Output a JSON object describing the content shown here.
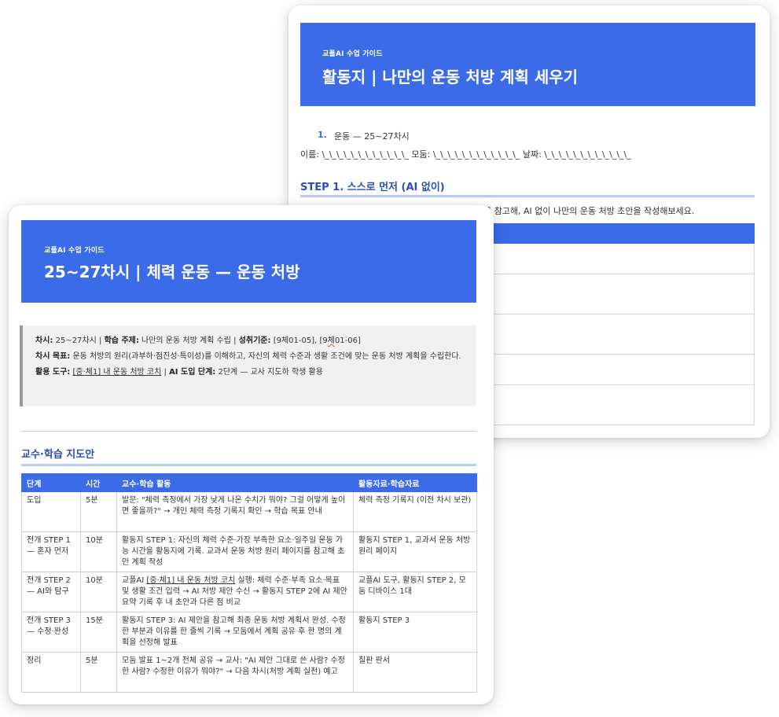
{
  "back": {
    "banner": {
      "sub": "교플AI 수업 가이드",
      "title": "활동지 | 나만의 운동 처방 계획 세우기"
    },
    "list_item": {
      "num": "1.",
      "text": "운동 — 25~27차시"
    },
    "name_line": "이름: \\_\\_\\_\\_\\_\\_\\_\\_\\_\\_\\_\\_ 모둠: \\_\\_\\_\\_\\_\\_\\_\\_\\_\\_\\_\\_ 날짜: \\_\\_\\_\\_\\_\\_\\_\\_\\_\\_\\_\\_",
    "step1": {
      "title": "STEP 1. 스스로 먼저 (AI 없이)",
      "desc_visible": "를 참고해, AI 없이 나만의 운동 처방 초안을 작성해보세요."
    }
  },
  "front": {
    "banner": {
      "sub": "교플AI 수업 가이드",
      "title": "25~27차시 | 체력 운동 — 운동 처방"
    },
    "info": {
      "l1_k1": "차시:",
      "l1_v1": "25~27차시 |",
      "l1_k2": "학습 주제:",
      "l1_v2": "나만의 운동 처방 계획 수립 |",
      "l1_k3": "성취기준:",
      "l1_v3a": "[9체01-05], [9",
      "l1_v3b": "체",
      "l1_v3c": "01-06]",
      "l2_k": "차시 목표:",
      "l2_v": "운동 처방의 원리(과부하·점진성·특이성)를 이해하고, 자신의 체력 수준과 생활 조건에 맞는 운동 처방 계획을 수립한다.",
      "l3_k1": "활용 도구:",
      "l3_v1": "[중·체1] 내 운동 처방 코치",
      "l3_sep": " | ",
      "l3_k2": "AI 도입 단계:",
      "l3_v2": "2단계 — 교사 지도하 학생 활용"
    },
    "section_title": "교수·학습 지도안",
    "table": {
      "headers": [
        "단계",
        "시간",
        "교수·학습 활동",
        "활동자료·학습자료"
      ],
      "rows": [
        {
          "stage": "도입",
          "time": "5분",
          "activity": "발문: \"체력 측정에서 가장 낮게 나온 수치가 뭐야? 그걸 어떻게 높이면 좋을까?\" → 개인 체력 측정 기록지 확인 → 학습 목표 안내",
          "material": "체력 측정 기록지 (이전 차시 보관)"
        },
        {
          "stage": "전개 STEP 1 — 혼자 먼저",
          "time": "10분",
          "activity": "활동지 STEP 1: 자신의 체력 수준·가장 부족한 요소·일주일 운동 가능 시간을 활동지에 기록. 교과서 운동 처방 원리 페이지를 참고해 초안 계획 작성",
          "material": "활동지 STEP 1, 교과서 운동 처방 원리 페이지"
        },
        {
          "stage": "전개 STEP 2 — AI와 탐구",
          "time": "10분",
          "activity_pre": "교플AI ",
          "activity_link": "[중·체1] 내 운동 처방 코치",
          "activity_post": " 실행: 체력 수준·부족 요소·목표 및 생활 조건 입력 → AI 처방 제안 수신 → 활동지 STEP 2에 AI 제안 요약 기록 후 내 초안과 다른 점 비교",
          "material": "교플AI 도구, 활동지 STEP 2, 모둠 디바이스 1대"
        },
        {
          "stage": "전개 STEP 3 — 수정·완성",
          "time": "15분",
          "activity": "활동지 STEP 3: AI 제안을 참고해 최종 운동 처방 계획서 완성. 수정한 부분과 이유를 한 줄씩 기록 → 모둠에서 계획 공유 후 한 명의 계획을 선정해 발표",
          "material": "활동지 STEP 3"
        },
        {
          "stage": "정리",
          "time": "5분",
          "activity": "모둠 발표 1~2개 전체 공유 → 교사: \"AI 제안 그대로 쓴 사람? 수정한 사람? 수정한 이유가 뭐야?\" → 다음 차시(처방 계획 실천) 예고",
          "material": "칠판 판서"
        }
      ]
    }
  }
}
